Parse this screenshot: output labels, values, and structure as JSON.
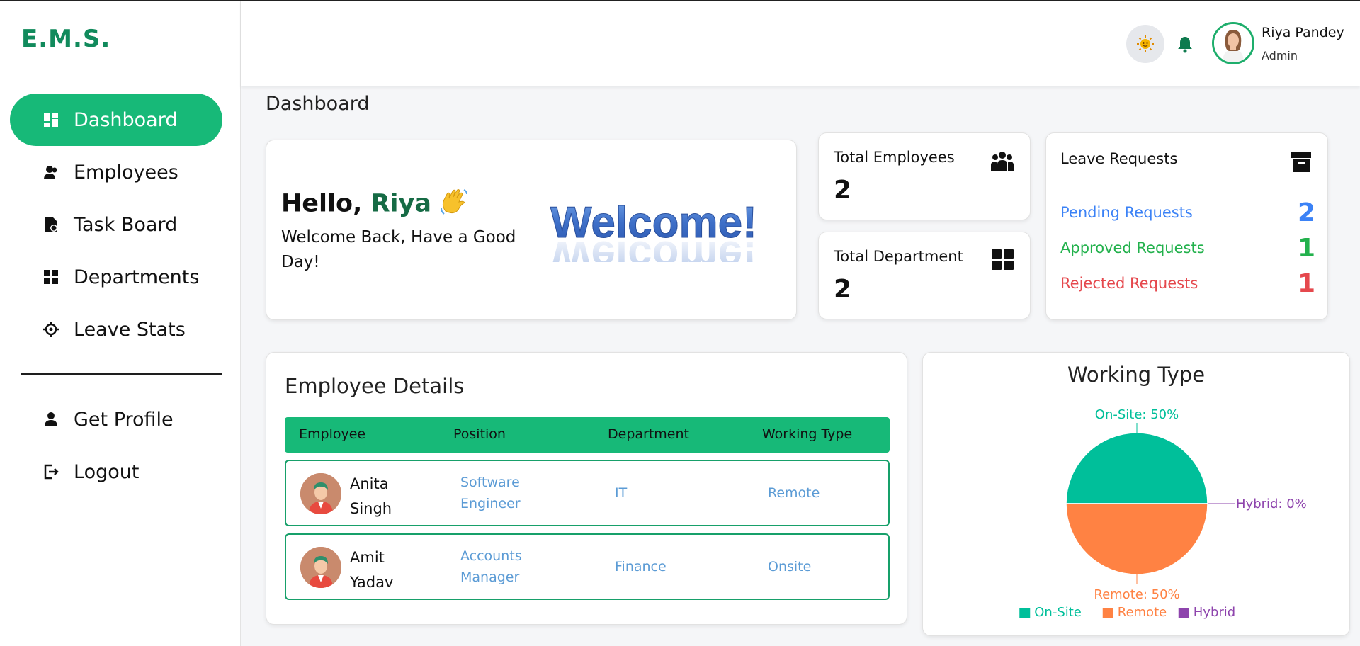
{
  "sidebar": {
    "logo": "E.M.S.",
    "items": [
      {
        "label": "Dashboard",
        "icon": "dashboard-icon"
      },
      {
        "label": "Employees",
        "icon": "employees-icon"
      },
      {
        "label": "Task Board",
        "icon": "task-board-icon"
      },
      {
        "label": "Departments",
        "icon": "departments-icon"
      },
      {
        "label": "Leave Stats",
        "icon": "leave-stats-icon"
      },
      {
        "label": "Get Profile",
        "icon": "profile-icon"
      },
      {
        "label": "Logout",
        "icon": "logout-icon"
      }
    ]
  },
  "header": {
    "user_name": "Riya Pandey",
    "user_role": "Admin"
  },
  "page_title": "Dashboard",
  "hello": {
    "greeting": "Hello, ",
    "name": "Riya",
    "subtitle": "Welcome Back, Have a Good Day!",
    "welcome_art": "Welcome!"
  },
  "stats": {
    "employees": {
      "label": "Total Employees",
      "value": "2"
    },
    "departments": {
      "label": "Total Department",
      "value": "2"
    }
  },
  "leave": {
    "title": "Leave Requests",
    "pending": {
      "label": "Pending Requests",
      "value": "2",
      "color": "#3b82f6"
    },
    "approved": {
      "label": "Approved Requests",
      "value": "1",
      "color": "#22b14c"
    },
    "rejected": {
      "label": "Rejected Requests",
      "value": "1",
      "color": "#e5484d"
    }
  },
  "employee_details": {
    "title": "Employee Details",
    "columns": [
      "Employee",
      "Position",
      "Department",
      "Working Type"
    ],
    "rows": [
      {
        "name": "Anita Singh",
        "position": "Software Engineer",
        "department": "IT",
        "working_type": "Remote"
      },
      {
        "name": "Amit Yadav",
        "position": "Accounts Manager",
        "department": "Finance",
        "working_type": "Onsite"
      }
    ]
  },
  "chart_data": {
    "type": "pie",
    "title": "Working Type",
    "categories": [
      "On-Site",
      "Remote",
      "Hybrid"
    ],
    "values": [
      50,
      50,
      0
    ],
    "colors": [
      "#00bf9a",
      "#ff8243",
      "#8e44ad"
    ],
    "slice_labels": [
      "On-Site: 50%",
      "Remote: 50%",
      "Hybrid: 0%"
    ],
    "legend": "bottom"
  }
}
